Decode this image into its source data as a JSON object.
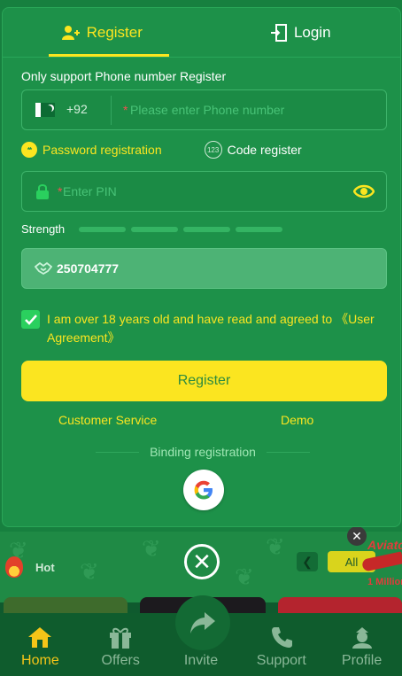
{
  "modal": {
    "tabs": [
      {
        "label": "Register",
        "icon": "user-add-icon",
        "active": true
      },
      {
        "label": "Login",
        "icon": "login-door-icon",
        "active": false
      }
    ],
    "support_label": "Only support Phone number Register",
    "phone": {
      "country_code": "+92",
      "flag": "pakistan-flag-icon",
      "required_mark": "*",
      "placeholder": "Please enter Phone number",
      "value": ""
    },
    "registration_types": [
      {
        "label": "Password registration",
        "icon_text": "**",
        "active": true
      },
      {
        "label": "Code register",
        "icon_text": "123",
        "active": false
      }
    ],
    "pin": {
      "required_mark": "*",
      "placeholder": "Enter PIN",
      "value": ""
    },
    "strength": {
      "label": "Strength",
      "segments": 4,
      "level": 0
    },
    "referral": {
      "value": "250704777"
    },
    "agreement": {
      "checked": true,
      "text": "I am over 18 years old and have read and agreed to",
      "link_text": "《User Agreement》"
    },
    "register_button": "Register",
    "links": {
      "customer_service": "Customer Service",
      "demo": "Demo"
    },
    "binding_label": "Binding registration",
    "social": [
      "google-icon"
    ]
  },
  "background": {
    "category_label": "Hot",
    "all_button": "All",
    "promo_title": "Aviator",
    "promo_amount": "1 Million"
  },
  "nav": {
    "items": [
      {
        "label": "Home",
        "icon": "home-icon",
        "active": true
      },
      {
        "label": "Offers",
        "icon": "gift-icon",
        "active": false
      },
      {
        "label": "Invite",
        "icon": "share-icon",
        "active": false
      },
      {
        "label": "Support",
        "icon": "phone-icon",
        "active": false
      },
      {
        "label": "Profile",
        "icon": "profile-icon",
        "active": false
      }
    ]
  },
  "colors": {
    "modal_bg": "#1d9149",
    "accent": "#fbe520",
    "nav_bg": "#0f5c2d",
    "placeholder": "#48c377"
  }
}
